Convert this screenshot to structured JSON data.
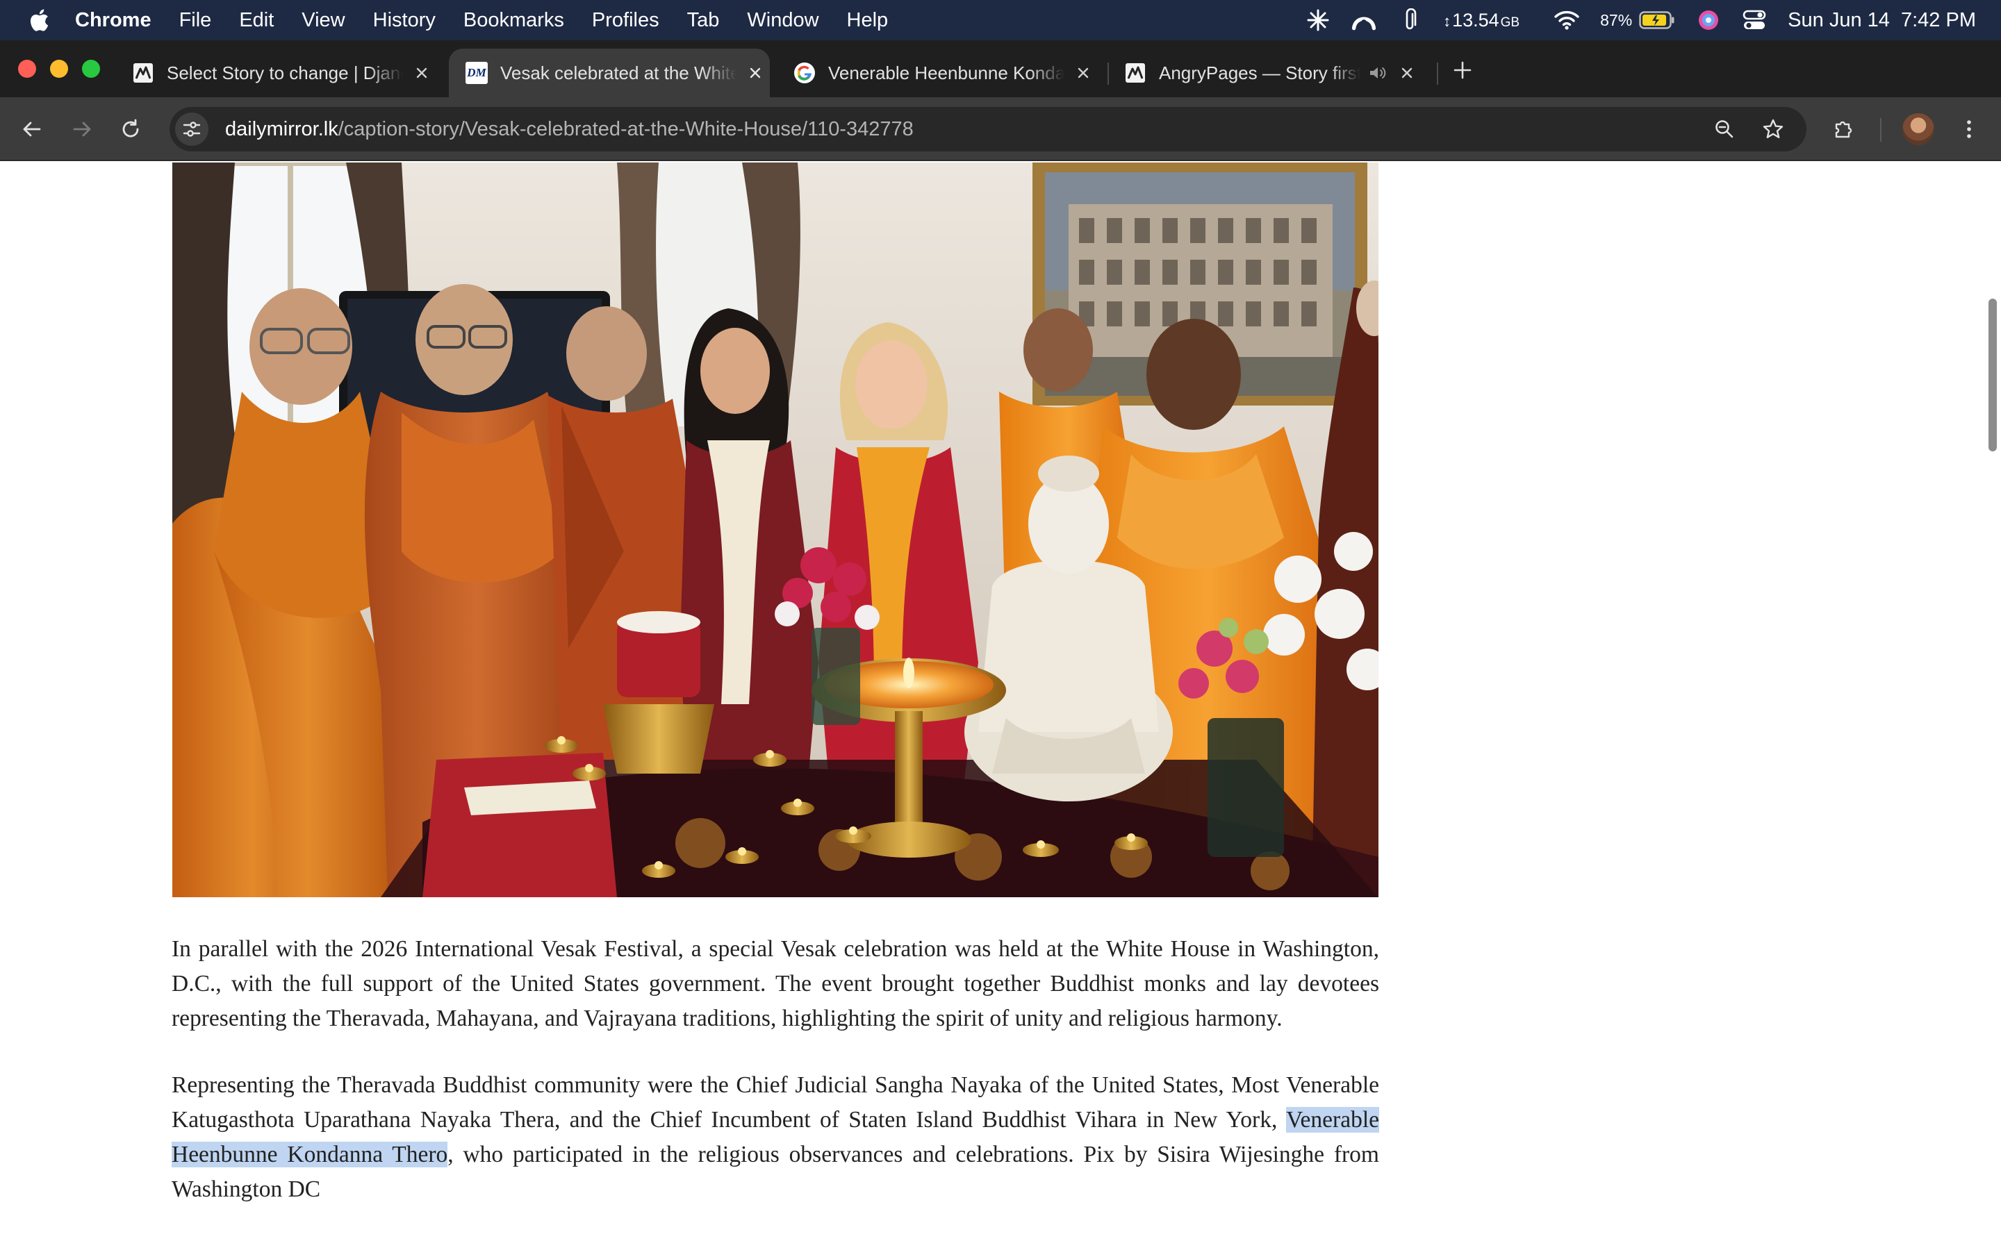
{
  "menubar": {
    "app_name": "Chrome",
    "items": [
      "File",
      "Edit",
      "View",
      "History",
      "Bookmarks",
      "Profiles",
      "Tab",
      "Window",
      "Help"
    ],
    "memory": "13.54",
    "memory_unit": "GB",
    "battery": "87%",
    "datetime": "Sun Jun 14  7:42 PM"
  },
  "tabs": [
    {
      "title": "Select Story to change | Django",
      "favicon": "django-favicon"
    },
    {
      "title": "Vesak celebrated at the White House",
      "favicon": "dailymirror-favicon",
      "favicon_text": "DM"
    },
    {
      "title": "Venerable Heenbunne Kondanna",
      "favicon": "google-favicon"
    },
    {
      "title": "AngryPages — Story first",
      "favicon": "angrypages-favicon"
    }
  ],
  "toolbar": {
    "url_host": "dailymirror.lk",
    "url_path": "/caption-story/Vesak-celebrated-at-the-White-House/110-342778"
  },
  "article": {
    "paragraph1": "In parallel with the 2026 International Vesak Festival, a special Vesak celebration was held at the White House in Washington, D.C., with the full support of the United States government. The event brought together Buddhist monks and lay devotees representing the Theravada, Mahayana, and Vajrayana traditions, highlighting the spirit of unity and religious harmony.",
    "paragraph2_before": "Representing the Theravada Buddhist community were the Chief Judicial Sangha Nayaka of the United States, Most Venerable Katugasthota Uparathana Nayaka Thera, and the Chief Incumbent of Staten Island Buddhist Vihara in New York, ",
    "paragraph2_highlight": "Venerable Heenbunne Kondanna Thero",
    "paragraph2_after": ", who participated in the religious observances and celebrations. Pix by Sisira Wijesinghe from Washington DC"
  },
  "colors": {
    "menubar_bg": "#1e2a44",
    "tabstrip_bg": "#1f1f1f",
    "toolbar_bg": "#3c3c3c",
    "selection_highlight": "#bfd5f1",
    "robe_orange": "#d9761f"
  }
}
